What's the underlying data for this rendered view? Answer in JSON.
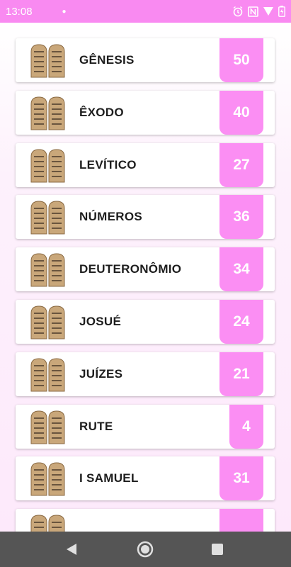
{
  "status_bar": {
    "time": "13:08",
    "icons": [
      "dot-icon",
      "alarm-icon",
      "nfc-icon",
      "wifi-icon",
      "battery-icon"
    ]
  },
  "books": [
    {
      "name": "GÊNESIS",
      "chapters": "50"
    },
    {
      "name": "ÊXODO",
      "chapters": "40"
    },
    {
      "name": "LEVÍTICO",
      "chapters": "27"
    },
    {
      "name": "NÚMEROS",
      "chapters": "36"
    },
    {
      "name": "DEUTERONÔMIO",
      "chapters": "34"
    },
    {
      "name": "JOSUÉ",
      "chapters": "24"
    },
    {
      "name": "JUÍZES",
      "chapters": "21"
    },
    {
      "name": "RUTE",
      "chapters": "4"
    },
    {
      "name": "I SAMUEL",
      "chapters": "31"
    },
    {
      "name": "",
      "chapters": ""
    }
  ],
  "nav_bar": {
    "buttons": [
      "back-icon",
      "home-icon",
      "recents-icon"
    ]
  },
  "colors": {
    "accent": "#f98af1",
    "badge": "#fb8ef3",
    "nav_bar": "#555555"
  }
}
